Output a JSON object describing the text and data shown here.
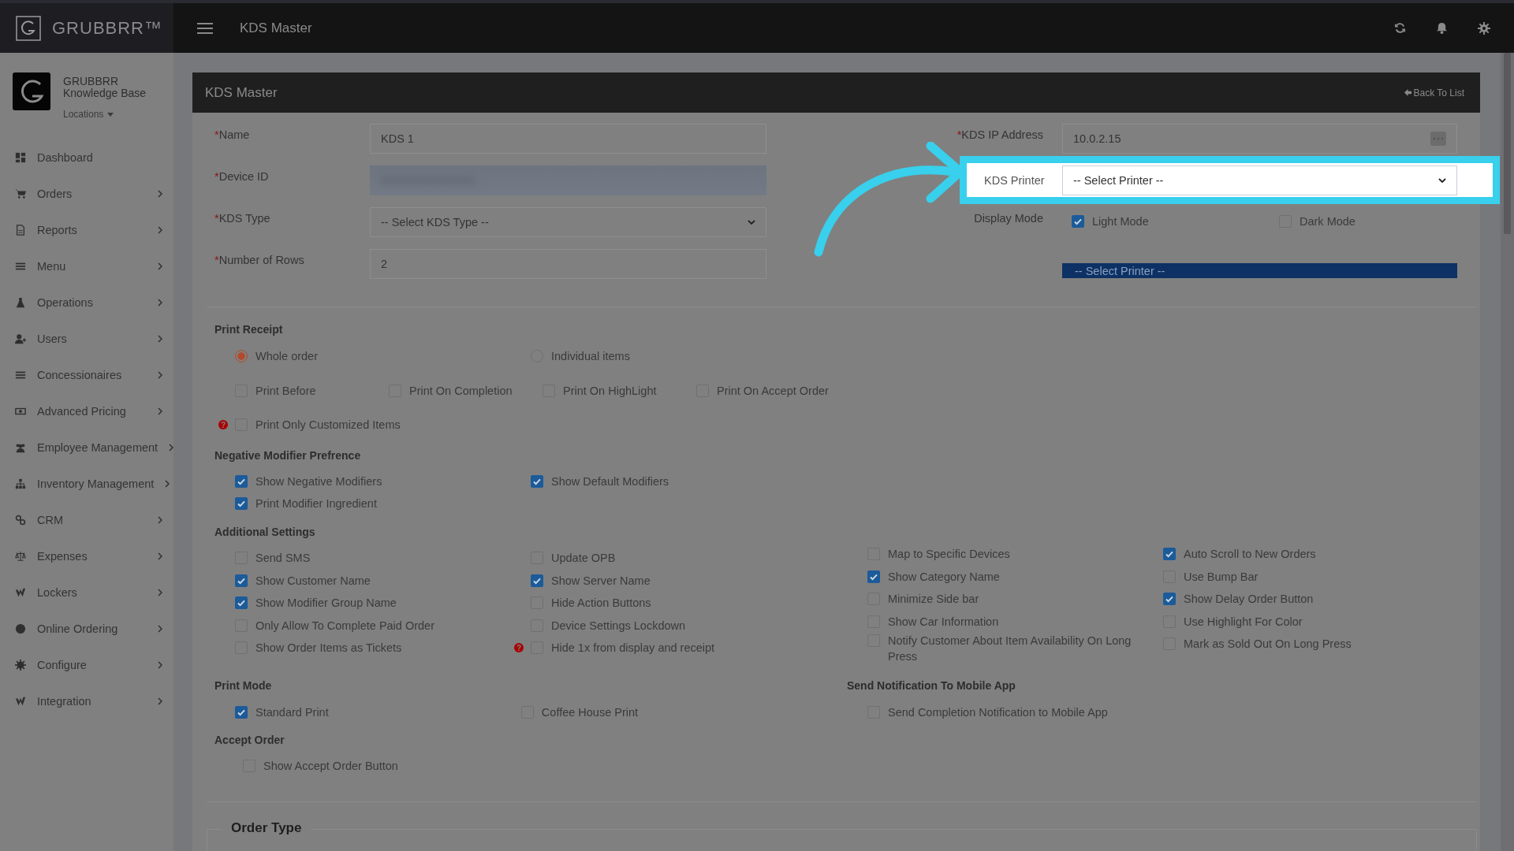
{
  "brand": {
    "name": "GRUBBRR™"
  },
  "topbar": {
    "title": "KDS Master"
  },
  "profile": {
    "line1": "GRUBBRR",
    "line2": "Knowledge Base",
    "locations": "Locations"
  },
  "sidebar": {
    "items": [
      {
        "label": "Dashboard",
        "expandable": false
      },
      {
        "label": "Orders",
        "expandable": true
      },
      {
        "label": "Reports",
        "expandable": true
      },
      {
        "label": "Menu",
        "expandable": true
      },
      {
        "label": "Operations",
        "expandable": true
      },
      {
        "label": "Users",
        "expandable": true
      },
      {
        "label": "Concessionaires",
        "expandable": true
      },
      {
        "label": "Advanced Pricing",
        "expandable": true
      },
      {
        "label": "Employee Management",
        "expandable": true
      },
      {
        "label": "Inventory Management",
        "expandable": true
      },
      {
        "label": "CRM",
        "expandable": true
      },
      {
        "label": "Expenses",
        "expandable": true
      },
      {
        "label": "Lockers",
        "expandable": true
      },
      {
        "label": "Online Ordering",
        "expandable": true
      },
      {
        "label": "Configure",
        "expandable": true
      },
      {
        "label": "Integration",
        "expandable": true
      }
    ]
  },
  "panel": {
    "title": "KDS Master",
    "back_link": "Back To List"
  },
  "form_left": [
    {
      "label": "Name",
      "required_mark": "*",
      "kind": "text",
      "value": "KDS 1"
    },
    {
      "label": "Device ID",
      "required_mark": "*",
      "kind": "blurred"
    },
    {
      "label": "KDS Type",
      "required_mark": "*",
      "kind": "select",
      "value": "-- Select KDS Type --"
    },
    {
      "label": "Number of Rows",
      "required_mark": "*",
      "kind": "text",
      "value": "2"
    }
  ],
  "ip_address": {
    "label": "KDS IP Address",
    "required_mark": "*",
    "value": "10.0.2.15"
  },
  "printer": {
    "label": "KDS Printer",
    "value": "-- Select Printer --",
    "highlighted": true,
    "open_option": "-- Select Printer --"
  },
  "display_mode": {
    "label": "Display Mode",
    "options": [
      {
        "label": "Light Mode",
        "checked": true
      },
      {
        "label": "Dark Mode",
        "checked": false
      }
    ]
  },
  "print_receipt": {
    "title": "Print Receipt",
    "radios": [
      {
        "label": "Whole order",
        "selected": true
      },
      {
        "label": "Individual items",
        "selected": false
      }
    ],
    "checks": [
      {
        "label": "Print Before",
        "checked": false
      },
      {
        "label": "Print On Completion",
        "checked": false
      },
      {
        "label": "Print On HighLight",
        "checked": false
      },
      {
        "label": "Print On Accept Order",
        "checked": false
      }
    ],
    "extra": {
      "label": "Print Only Customized Items",
      "checked": false,
      "help": "?"
    }
  },
  "negative_modifier": {
    "title": "Negative Modifier Prefrence",
    "columns": [
      [
        {
          "label": "Show Negative Modifiers",
          "checked": true
        },
        {
          "label": "Print Modifier Ingredient",
          "checked": true
        }
      ],
      [
        {
          "label": "Show Default Modifiers",
          "checked": true
        }
      ]
    ]
  },
  "additional_settings": {
    "title": "Additional Settings",
    "columns": [
      [
        {
          "label": "Send SMS",
          "checked": false
        },
        {
          "label": "Show Customer Name",
          "checked": true
        },
        {
          "label": "Show Modifier Group Name",
          "checked": true
        },
        {
          "label": "Only Allow To Complete Paid Order",
          "checked": false
        },
        {
          "label": "Show Order Items as Tickets",
          "checked": false
        }
      ],
      [
        {
          "label": "Update OPB",
          "checked": false
        },
        {
          "label": "Show Server Name",
          "checked": true
        },
        {
          "label": "Hide Action Buttons",
          "checked": false
        },
        {
          "label": "Device Settings Lockdown",
          "checked": false
        },
        {
          "label": "Hide 1x from display and receipt",
          "checked": false,
          "help": "?"
        }
      ],
      [
        {
          "label": "Map to Specific Devices",
          "checked": false
        },
        {
          "label": "Show Category Name",
          "checked": true
        },
        {
          "label": "Minimize Side bar",
          "checked": false
        },
        {
          "label": "Show Car Information",
          "checked": false
        },
        {
          "label": "Notify Customer About Item Availability On Long Press",
          "checked": false
        }
      ],
      [
        {
          "label": "Auto Scroll to New Orders",
          "checked": true
        },
        {
          "label": "Use Bump Bar",
          "checked": false
        },
        {
          "label": "Show Delay Order Button",
          "checked": true
        },
        {
          "label": "Use Highlight For Color",
          "checked": false
        },
        {
          "label": "Mark as Sold Out On Long Press",
          "checked": false
        }
      ]
    ]
  },
  "print_mode": {
    "title": "Print Mode",
    "columns": [
      [
        {
          "label": "Standard Print",
          "checked": true
        }
      ],
      [
        {
          "label": "Coffee House Print",
          "checked": false
        }
      ]
    ]
  },
  "notification": {
    "title": "Send Notification To Mobile App",
    "columns": [
      [
        {
          "label": "Send Completion Notification to Mobile App",
          "checked": false
        }
      ]
    ]
  },
  "accept_order": {
    "title": "Accept Order",
    "columns": [
      [
        {
          "label": "Show Accept Order Button",
          "checked": false
        }
      ]
    ]
  },
  "order_type": {
    "title": "Order Type"
  }
}
